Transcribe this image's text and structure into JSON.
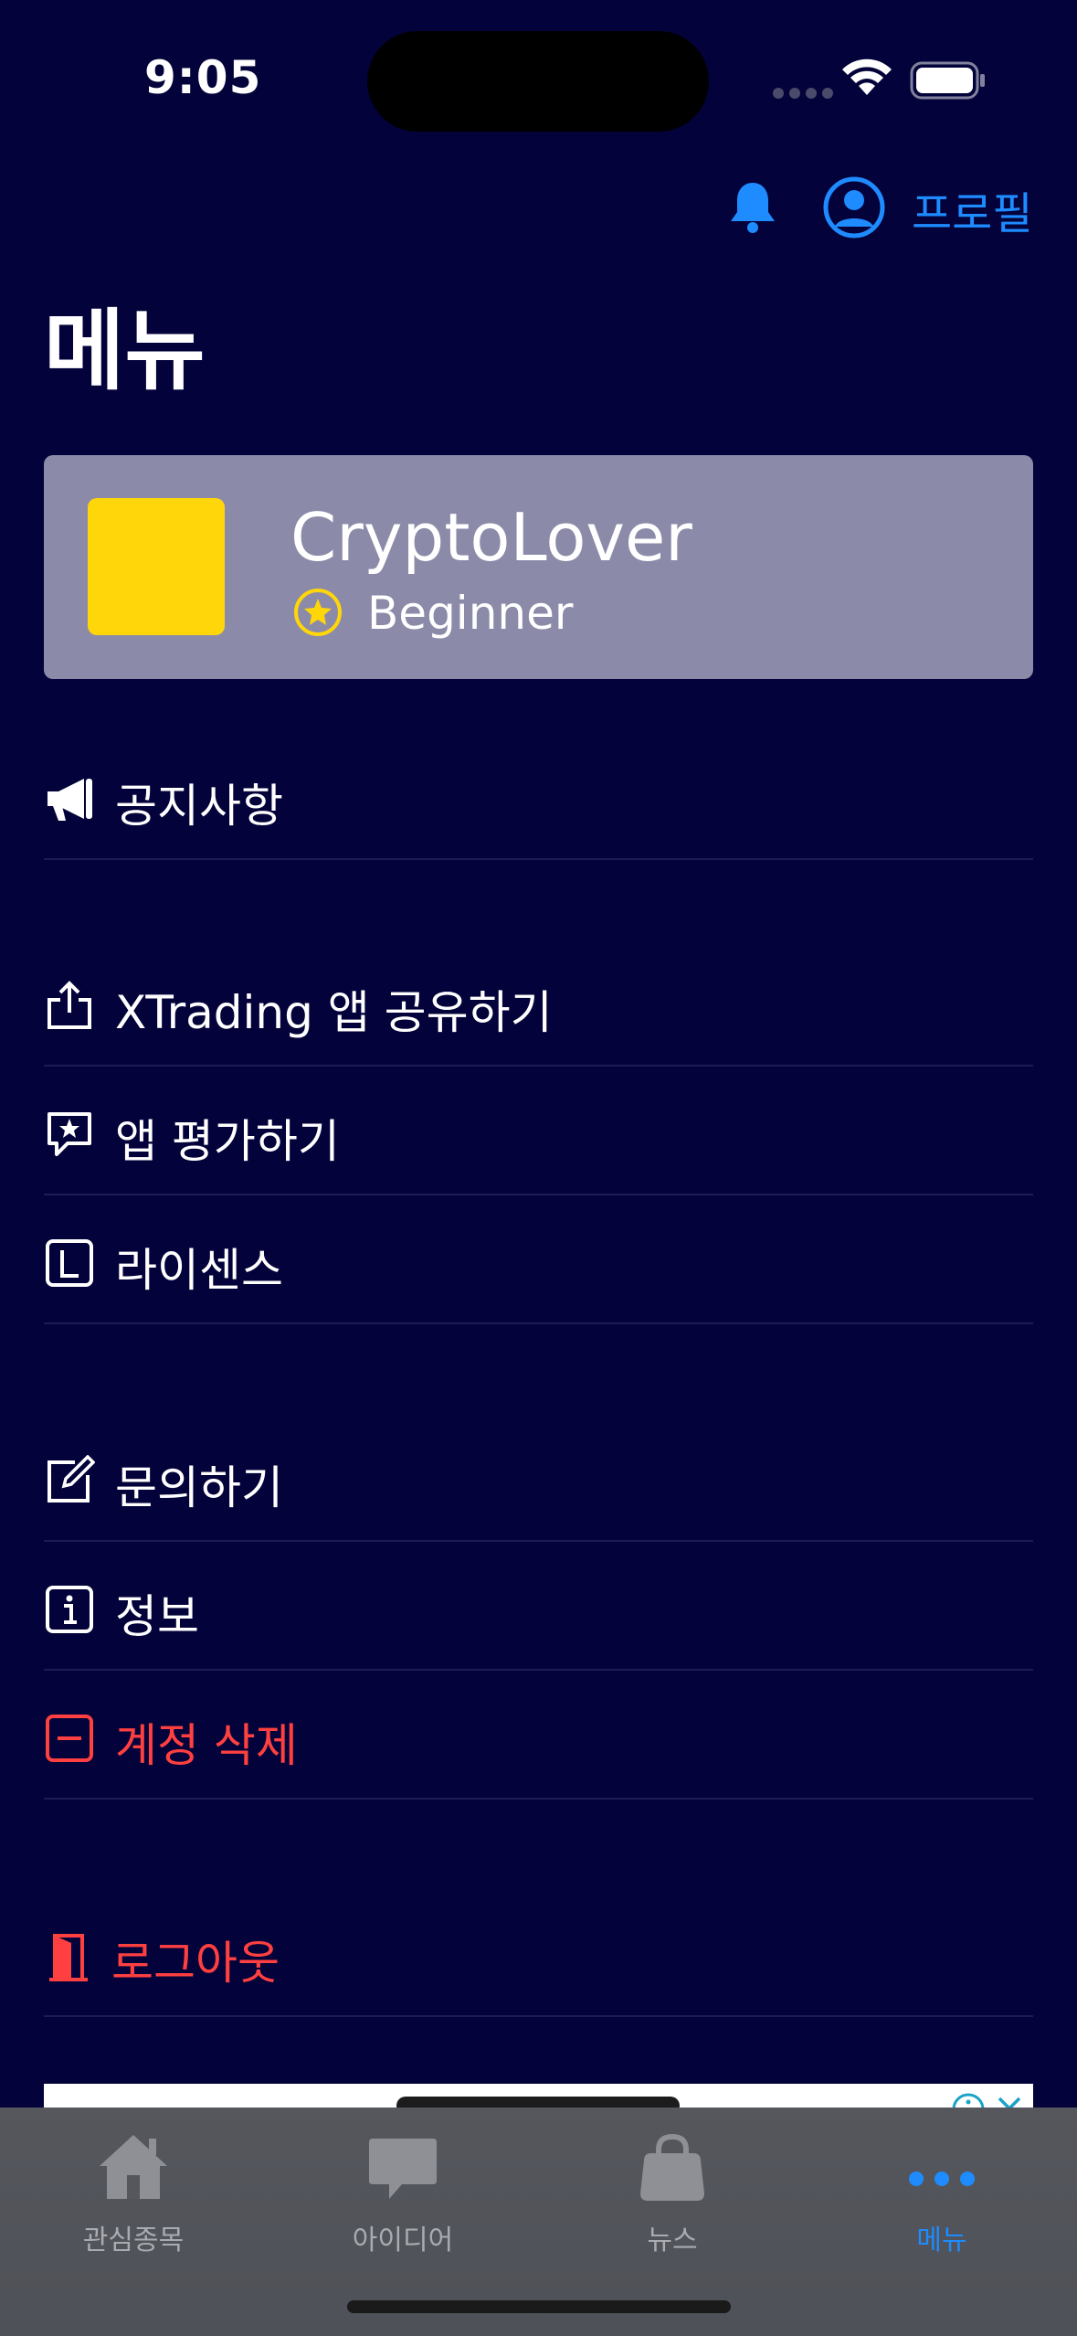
{
  "status_bar": {
    "time": "9:05"
  },
  "header": {
    "profile_label": "프로필",
    "title": "메뉴"
  },
  "user": {
    "name": "CryptoLover",
    "rank": "Beginner"
  },
  "menu": {
    "notice": "공지사항",
    "share": "XTrading 앱 공유하기",
    "rate": "앱 평가하기",
    "license": "라이센스",
    "contact": "문의하기",
    "info": "정보",
    "delete_account": "계정 삭제",
    "logout": "로그아웃"
  },
  "tabs": [
    {
      "label": "관심종목",
      "icon": "home-icon"
    },
    {
      "label": "아이디어",
      "icon": "chat-bubble-icon"
    },
    {
      "label": "뉴스",
      "icon": "bag-icon"
    },
    {
      "label": "메뉴",
      "icon": "more-icon"
    }
  ],
  "colors": {
    "accent": "#1e8bff",
    "danger": "#ff4040",
    "background": "#03023a",
    "avatar": "#ffd60a"
  }
}
